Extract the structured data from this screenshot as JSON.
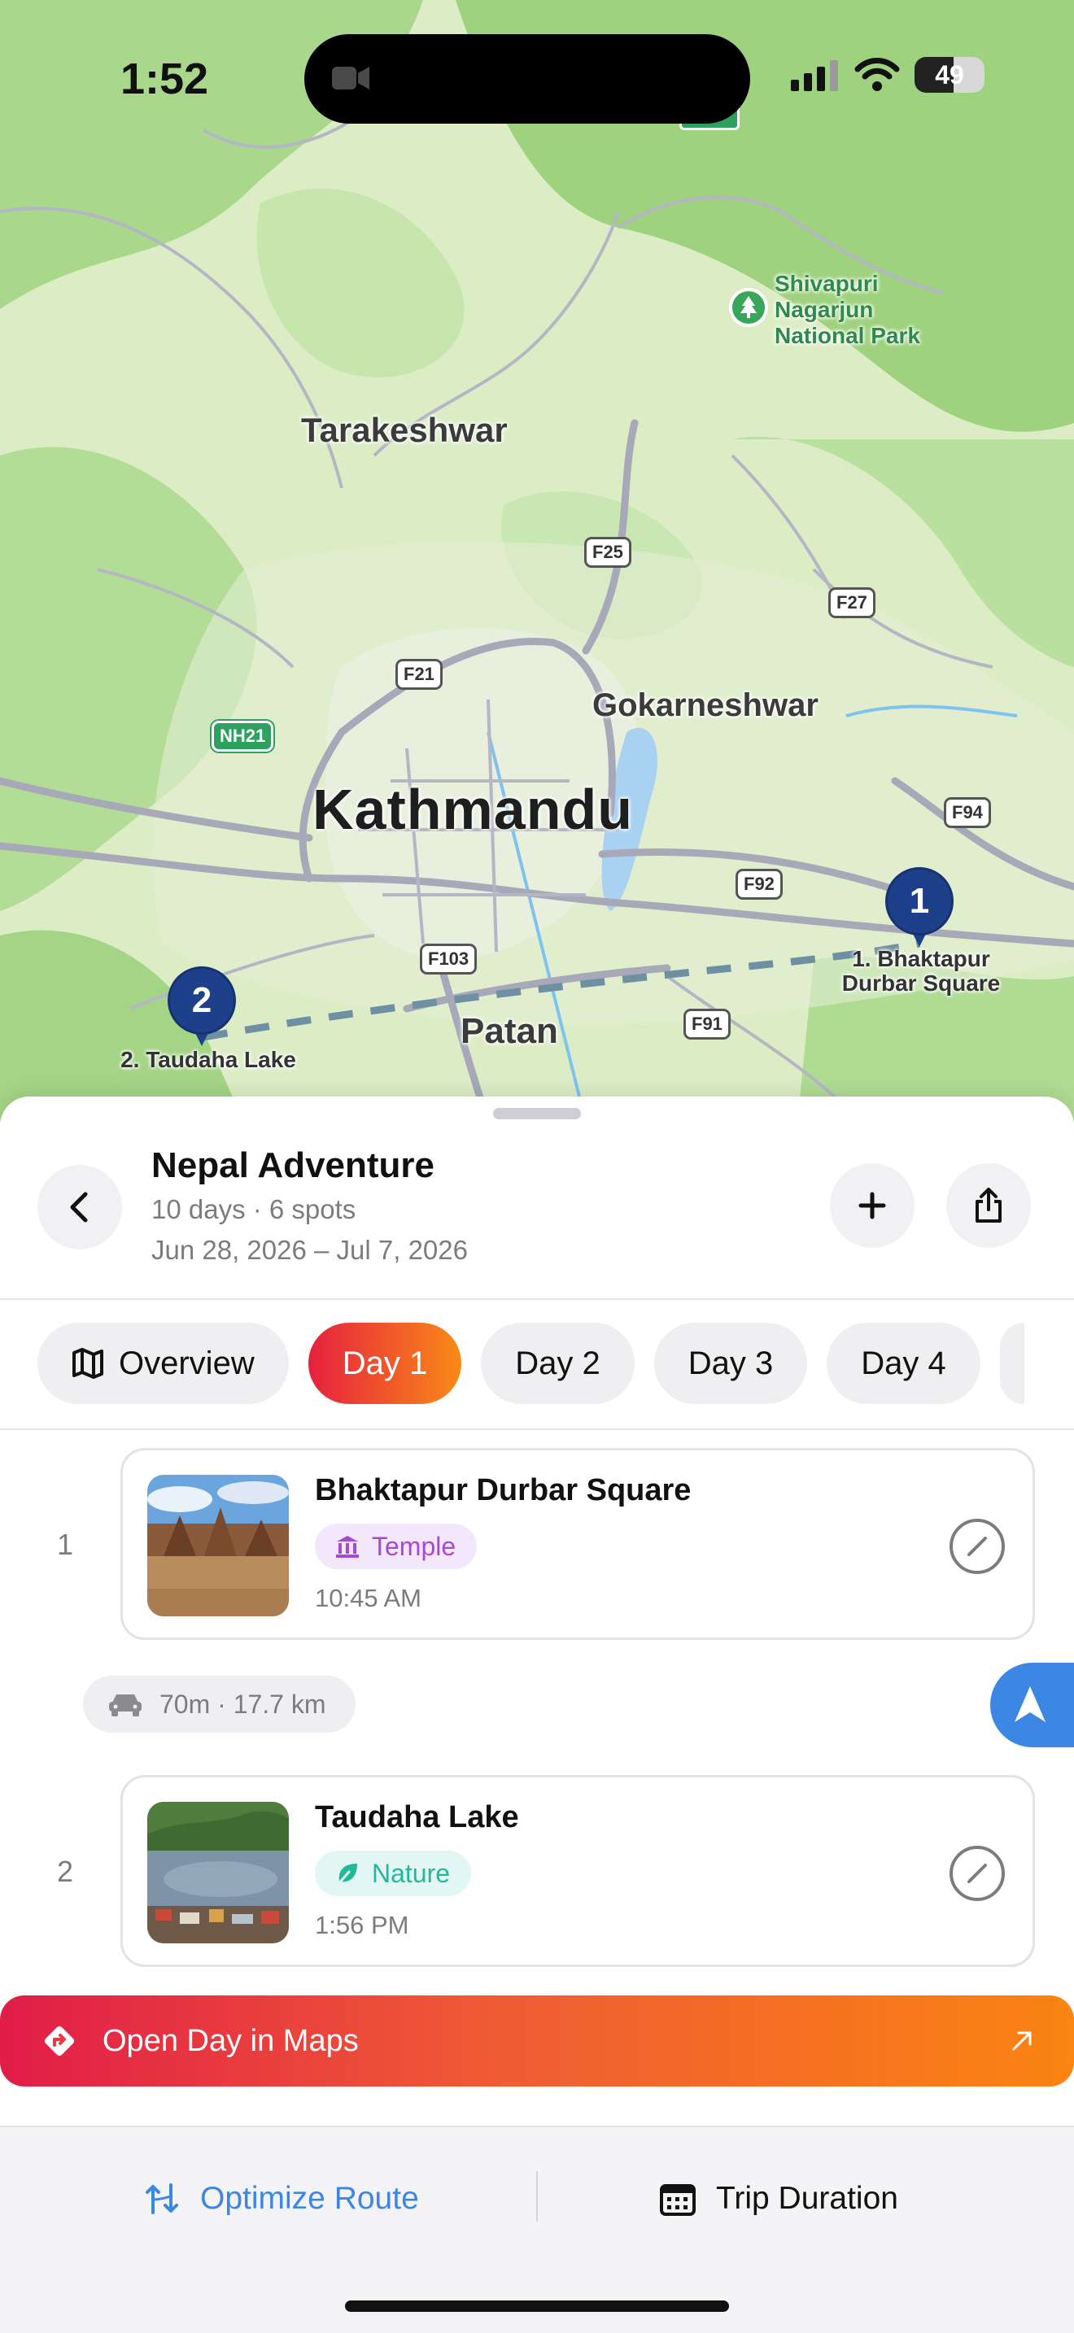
{
  "status_bar": {
    "time": "1:52",
    "battery": "49"
  },
  "map": {
    "labels": {
      "park": "Shivapuri Nagarjun National Park",
      "tarakeshwar": "Tarakeshwar",
      "gokarneshwar": "Gokarneshwar",
      "kathmandu": "Kathmandu",
      "patan": "Patan"
    },
    "roads": [
      "F25",
      "F27",
      "F21",
      "NH21",
      "F94",
      "F92",
      "F103",
      "F91"
    ],
    "pins": [
      {
        "number": "1",
        "label": "1. Bhaktapur Durbar Square"
      },
      {
        "number": "2",
        "label": "2. Taudaha Lake"
      }
    ]
  },
  "trip": {
    "title": "Nepal Adventure",
    "meta": "10 days · 6 spots",
    "dates": "Jun 28, 2026 – Jul 7, 2026"
  },
  "tabs": [
    "Overview",
    "Day 1",
    "Day 2",
    "Day 3",
    "Day 4"
  ],
  "active_tab": "Day 1",
  "stops": [
    {
      "index": "1",
      "name": "Bhaktapur Durbar Square",
      "category": "Temple",
      "time": "10:45 AM"
    },
    {
      "index": "2",
      "name": "Taudaha Lake",
      "category": "Nature",
      "time": "1:56 PM"
    }
  ],
  "travel_segment": "70m · 17.7 km",
  "actions": {
    "open_maps": "Open Day in Maps",
    "optimize": "Optimize Route",
    "duration": "Trip Duration"
  },
  "colors": {
    "accent_blue": "#3c86e4",
    "gradient_start": "#e6213f",
    "gradient_end": "#f98a17",
    "pin": "#1e3f8a",
    "temple": "#a74ad1",
    "nature": "#24b89a"
  }
}
